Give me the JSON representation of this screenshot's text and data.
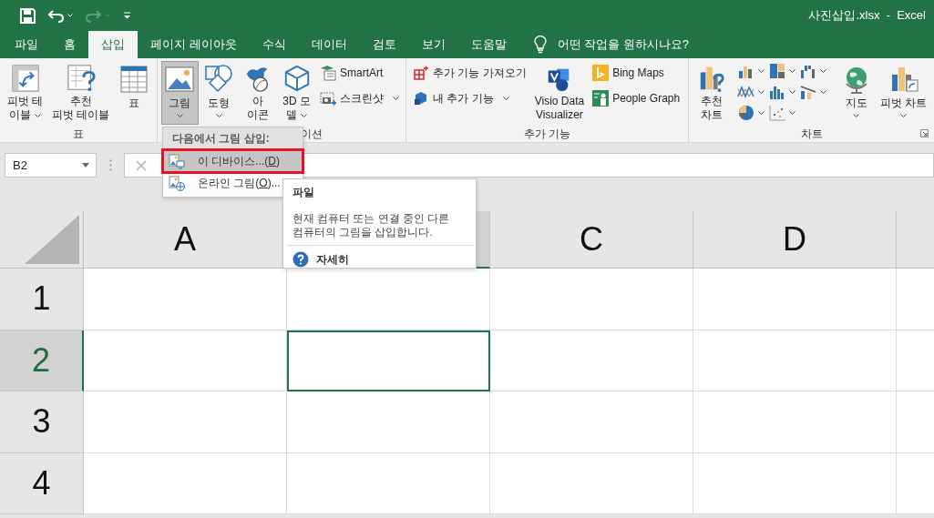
{
  "window": {
    "title": "사진삽입.xlsx  -  Excel"
  },
  "quick_access": [
    {
      "kind": "save",
      "disabled": false,
      "dropdown": false
    },
    {
      "kind": "undo",
      "disabled": false,
      "dropdown": true
    },
    {
      "kind": "redo",
      "disabled": true,
      "dropdown": true
    },
    {
      "kind": "customize",
      "disabled": false,
      "dropdown": false
    }
  ],
  "tabs": [
    {
      "label": "파일",
      "selected": false
    },
    {
      "label": "홈",
      "selected": false
    },
    {
      "label": "삽입",
      "selected": true
    },
    {
      "label": "페이지 레이아웃",
      "selected": false
    },
    {
      "label": "수식",
      "selected": false
    },
    {
      "label": "데이터",
      "selected": false
    },
    {
      "label": "검토",
      "selected": false
    },
    {
      "label": "보기",
      "selected": false
    },
    {
      "label": "도움말",
      "selected": false
    }
  ],
  "tell_me": "어떤 작업을 원하시나요?",
  "ribbon_groups": [
    {
      "label": "표",
      "items": [
        {
          "kind": "large",
          "lines": [
            "피벗 테",
            "이블"
          ],
          "dropdown": true,
          "selected": false
        },
        {
          "kind": "large",
          "lines": [
            "추천",
            "피벗 테이블"
          ],
          "dropdown": false,
          "selected": false
        },
        {
          "kind": "large",
          "lines": [
            "표"
          ],
          "dropdown": false,
          "selected": false
        }
      ]
    },
    {
      "label": "이션",
      "items": [
        {
          "kind": "large",
          "lines": [
            "그림"
          ],
          "dropdown": true,
          "selected": true
        },
        {
          "kind": "large",
          "lines": [
            "도형"
          ],
          "dropdown": true,
          "selected": false
        },
        {
          "kind": "large",
          "lines": [
            "아",
            "이콘"
          ],
          "dropdown": false,
          "selected": false
        },
        {
          "kind": "large",
          "lines": [
            "3D 모",
            "델"
          ],
          "dropdown": true,
          "selected": false
        },
        {
          "kind": "stack",
          "items": [
            {
              "label": "SmartArt",
              "dropdown": false
            },
            {
              "label": "스크린샷",
              "dropdown": true
            }
          ]
        }
      ]
    },
    {
      "label": "추가 기능",
      "items": [
        {
          "kind": "stack",
          "items": [
            {
              "label": "추가 기능 가져오기",
              "dropdown": false
            },
            {
              "label": "내 추가 기능",
              "dropdown": true
            }
          ]
        },
        {
          "kind": "large",
          "lines": [
            "Visio Data",
            "Visualizer"
          ],
          "dropdown": false,
          "selected": false
        },
        {
          "kind": "stack",
          "items": [
            {
              "label": "Bing Maps",
              "dropdown": false
            },
            {
              "label": "People Graph",
              "dropdown": false
            }
          ]
        }
      ]
    },
    {
      "label": "차트",
      "items": [
        {
          "kind": "large",
          "lines": [
            "추천",
            "차트"
          ],
          "dropdown": false,
          "selected": false
        },
        {
          "kind": "chart_types"
        },
        {
          "kind": "large",
          "lines": [
            "지도"
          ],
          "dropdown": true,
          "selected": false
        },
        {
          "kind": "large",
          "lines": [
            "피벗 차트"
          ],
          "dropdown": true,
          "selected": false
        }
      ]
    }
  ],
  "name_box": {
    "value": "B2"
  },
  "columns": [
    {
      "label": "A",
      "selected": false
    },
    {
      "selected": true
    },
    {
      "label": "C",
      "selected": false
    },
    {
      "label": "D",
      "selected": false
    },
    {
      "selected": false
    }
  ],
  "rows": [
    {
      "label": "1",
      "selected": false
    },
    {
      "label": "2",
      "selected": true
    },
    {
      "label": "3",
      "selected": false
    },
    {
      "label": "4",
      "selected": false
    }
  ],
  "insert_picture_menu": {
    "heading": "다음에서 그림 삽입:",
    "items": [
      {
        "text_before": "이 디바이스...(",
        "key": "D",
        "text_after": ")",
        "highlighted": true
      },
      {
        "text_before": "온라인 그림(",
        "key": "O",
        "text_after": ")...",
        "highlighted": false
      }
    ]
  },
  "tooltip": {
    "title": "파일",
    "description": [
      "현재 컴퓨터 또는 연결 중인 다른",
      "컴퓨터의 그림을 삽입합니다."
    ],
    "link": "자세히"
  }
}
